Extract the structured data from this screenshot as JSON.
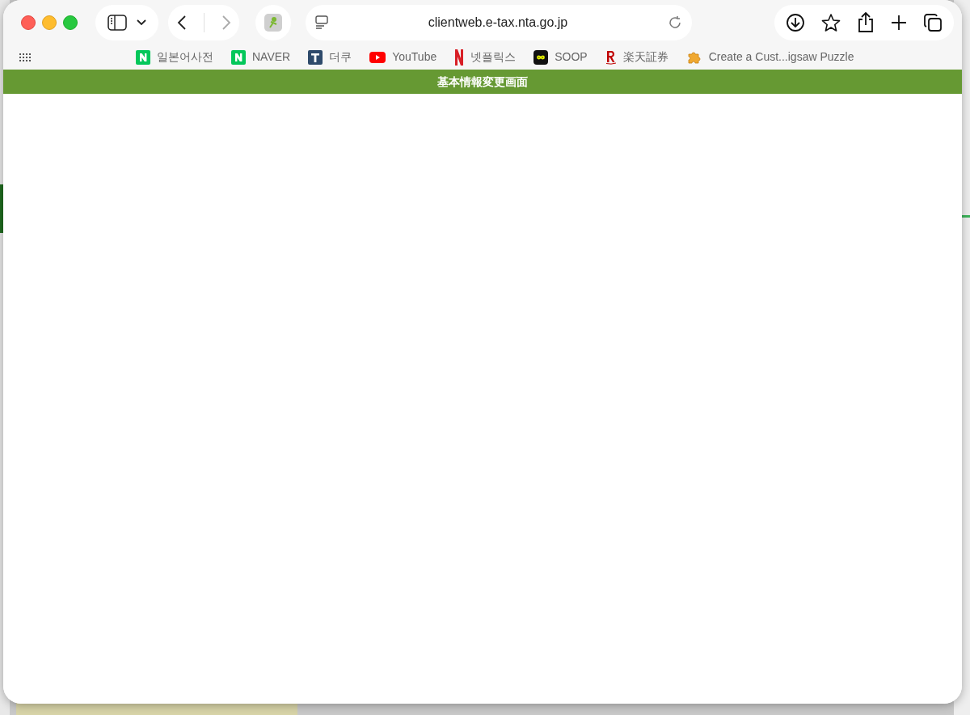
{
  "browser": {
    "url": "clientweb.e-tax.nta.go.jp",
    "bookmarks": [
      {
        "label": "일본어사전",
        "kind": "naver"
      },
      {
        "label": "NAVER",
        "kind": "naver"
      },
      {
        "label": "더쿠",
        "kind": "theqoo"
      },
      {
        "label": "YouTube",
        "kind": "youtube"
      },
      {
        "label": "넷플릭스",
        "kind": "netflix"
      },
      {
        "label": "SOOP",
        "kind": "soop"
      },
      {
        "label": "楽天証券",
        "kind": "rakuten"
      },
      {
        "label": "Create a Cust...igsaw Puzzle",
        "kind": "puzzle"
      }
    ]
  },
  "page": {
    "banner": "基本情報変更画面"
  }
}
